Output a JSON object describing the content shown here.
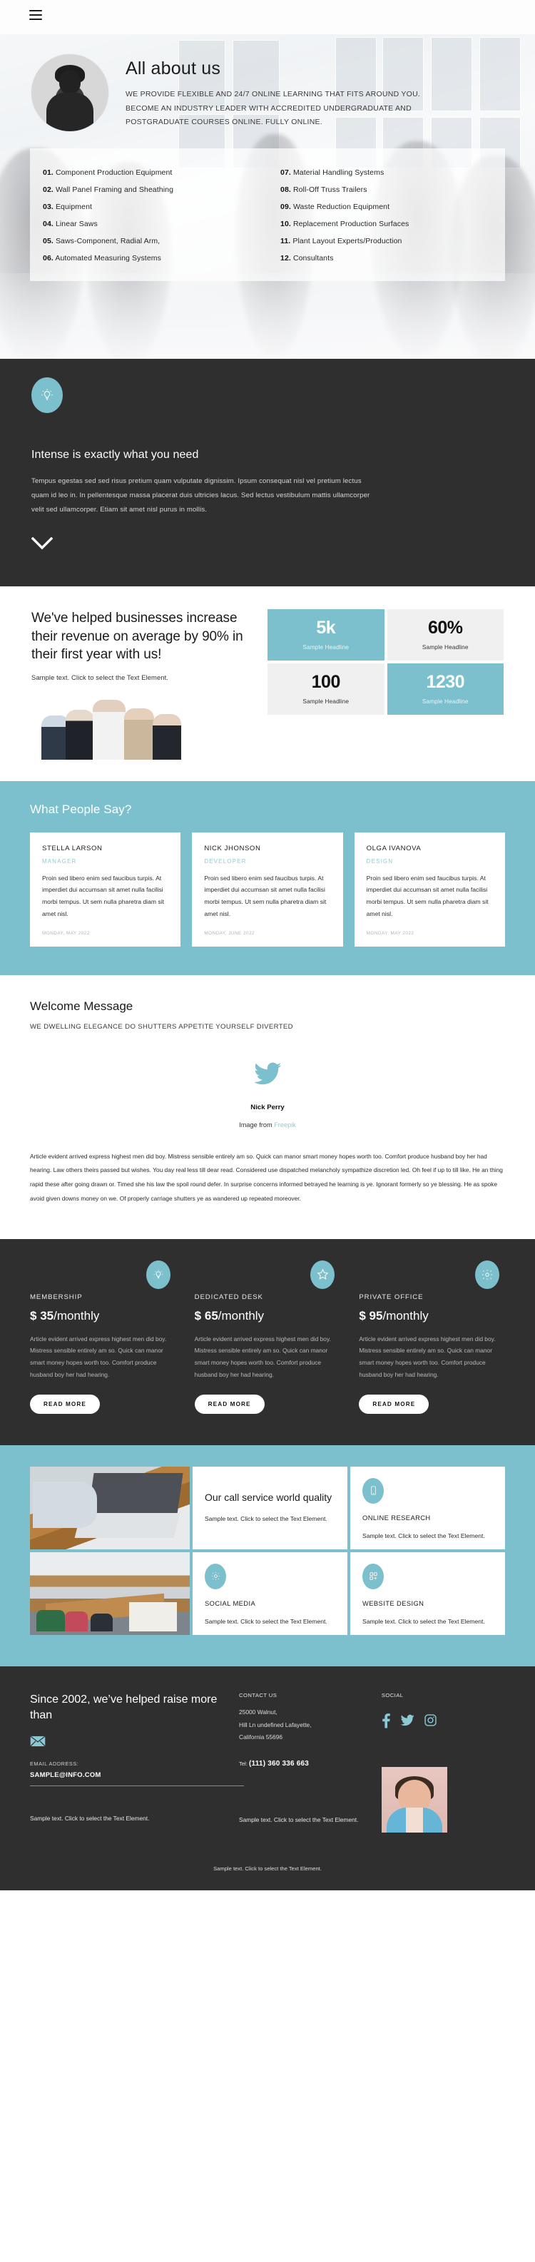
{
  "nav": {
    "menu_icon": "hamburger-icon"
  },
  "hero": {
    "title": "All about us",
    "subtitle": "WE PROVIDE FLEXIBLE AND 24/7 ONLINE LEARNING THAT FITS AROUND YOU. BECOME AN INDUSTRY LEADER WITH ACCREDITED UNDERGRADUATE AND POSTGRADUATE COURSES ONLINE. FULLY ONLINE.",
    "list_left": [
      {
        "num": "01.",
        "label": "Component Production Equipment"
      },
      {
        "num": "02.",
        "label": "Wall Panel Framing and Sheathing"
      },
      {
        "num": "03.",
        "label": "Equipment"
      },
      {
        "num": "04.",
        "label": "Linear Saws"
      },
      {
        "num": "05.",
        "label": "Saws-Component, Radial Arm,"
      },
      {
        "num": "06.",
        "label": "Automated Measuring Systems"
      }
    ],
    "list_right": [
      {
        "num": "07.",
        "label": "Material Handling Systems"
      },
      {
        "num": "08.",
        "label": "Roll-Off Truss Trailers"
      },
      {
        "num": "09.",
        "label": "Waste Reduction Equipment"
      },
      {
        "num": "10.",
        "label": "Replacement Production Surfaces"
      },
      {
        "num": "11.",
        "label": "Plant Layout Experts/Production"
      },
      {
        "num": "12.",
        "label": "Consultants"
      }
    ]
  },
  "intense": {
    "icon": "lightbulb-icon",
    "heading": "Intense is exactly what you need",
    "paragraph": "Tempus egestas sed sed risus pretium quam vulputate dignissim. Ipsum consequat nisl vel pretium lectus quam id leo in. In pellentesque massa placerat duis ultricies lacus. Sed lectus vestibulum mattis ullamcorper velit sed ullamcorper. Etiam sit amet nisl purus in mollis.",
    "scroll_icon": "chevron-down-icon"
  },
  "stats": {
    "heading": "We've helped businesses increase their revenue on average by 90% in their first year with us!",
    "subtext": "Sample text. Click to select the Text Element.",
    "cells": [
      {
        "value": "5k",
        "label": "Sample Headline",
        "style": "teal"
      },
      {
        "value": "60%",
        "label": "Sample Headline",
        "style": "grey"
      },
      {
        "value": "100",
        "label": "Sample Headline",
        "style": "grey"
      },
      {
        "value": "1230",
        "label": "Sample Headline",
        "style": "teal"
      }
    ]
  },
  "testimonials": {
    "heading": "What People Say?",
    "cards": [
      {
        "name": "STELLA LARSON",
        "role": "MANAGER",
        "body": "Proin sed libero enim sed faucibus turpis. At imperdiet dui accumsan sit amet nulla facilisi morbi tempus. Ut sem nulla pharetra diam sit amet nisl.",
        "date": "MONDAY, MAY 2022"
      },
      {
        "name": "NICK JHONSON",
        "role": "DEVELOPER",
        "body": "Proin sed libero enim sed faucibus turpis. At imperdiet dui accumsan sit amet nulla facilisi morbi tempus. Ut sem nulla pharetra diam sit amet nisl.",
        "date": "MONDAY, JUNE 2022"
      },
      {
        "name": "OLGA IVANOVA",
        "role": "DESIGN",
        "body": "Proin sed libero enim sed faucibus turpis. At imperdiet dui accumsan sit amet nulla facilisi morbi tempus. Ut sem nulla pharetra diam sit amet nisl.",
        "date": "MONDAY, MAY 2022"
      }
    ]
  },
  "welcome": {
    "heading": "Welcome Message",
    "subheading": "WE DWELLING ELEGANCE DO SHUTTERS APPETITE YOURSELF DIVERTED",
    "icon": "twitter-icon",
    "author": "Nick Perry",
    "credit_prefix": "Image from ",
    "credit_link": "Freepik",
    "article": "Article evident arrived express highest men did boy. Mistress sensible entirely am so. Quick can manor smart money hopes worth too. Comfort produce husband boy her had hearing. Law others theirs passed but wishes. You day real less till dear read. Considered use dispatched melancholy sympathize discretion led. Oh feel if up to till like. He an thing rapid these after going drawn or. Timed she his law the spoil round defer. In surprise concerns informed betrayed he learning is ye. Ignorant formerly so ye blessing. He as spoke avoid given downs money on we. Of properly carriage shutters ye as wandered up repeated moreover."
  },
  "pricing": {
    "plans": [
      {
        "icon": "lightbulb-icon",
        "title": "MEMBERSHIP",
        "currency": "$",
        "amount": "35",
        "period": "/monthly",
        "body": "Article evident arrived express highest men did boy. Mistress sensible entirely am so. Quick can manor smart money hopes worth too. Comfort produce husband boy her had hearing.",
        "button": "READ MORE"
      },
      {
        "icon": "star-icon",
        "title": "DEDICATED DESK",
        "currency": "$",
        "amount": "65",
        "period": "/monthly",
        "body": "Article evident arrived express highest men did boy. Mistress sensible entirely am so. Quick can manor smart money hopes worth too. Comfort produce husband boy her had hearing.",
        "button": "READ MORE"
      },
      {
        "icon": "gear-icon",
        "title": "PRIVATE OFFICE",
        "currency": "$",
        "amount": "95",
        "period": "/monthly",
        "body": "Article evident arrived express highest men did boy. Mistress sensible entirely am so. Quick can manor smart money hopes worth too. Comfort produce husband boy her had hearing.",
        "button": "READ MORE"
      }
    ]
  },
  "services": {
    "feature": {
      "heading": "Our call service world quality",
      "body": "Sample text. Click to select the Text Element."
    },
    "cards": [
      {
        "icon": "mobile-icon",
        "title": "ONLINE RESEARCH",
        "body": "Sample text. Click to select the Text Element."
      },
      {
        "icon": "gear-icon",
        "title": "SOCIAL MEDIA",
        "body": "Sample text. Click to select the Text Element."
      },
      {
        "icon": "grid-plus-icon",
        "title": "WEBSITE DESIGN",
        "body": "Sample text. Click to select the Text Element."
      }
    ]
  },
  "footer": {
    "heading": "Since 2002, we’ve helped raise more than",
    "mail_icon": "envelope-icon",
    "email_label": "EMAIL ADDRESS:",
    "email": "SAMPLE@INFO.COM",
    "contact_title": "CONTACT US",
    "address": "25000 Walnut,\nHill Ln undefined Lafayette,\nCalifornia 55696",
    "tel_label": "Tel:",
    "tel": "(111) 360 336 663",
    "social_title": "SOCIAL",
    "social": [
      "facebook-icon",
      "twitter-icon",
      "instagram-icon"
    ],
    "note_left": "Sample text. Click to select the Text Element.",
    "note_right": "Sample text. Click to select the Text Element.",
    "bottom": "Sample text. Click to select the Text Element."
  },
  "colors": {
    "accent": "#7cc0cd",
    "dark": "#2f2f2f",
    "grey": "#f0f0f0"
  }
}
